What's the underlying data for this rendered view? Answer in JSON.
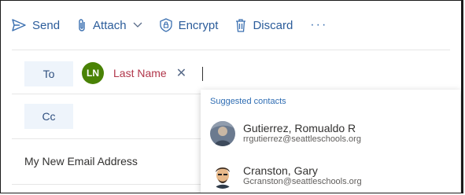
{
  "toolbar": {
    "send": "Send",
    "attach": "Attach",
    "encrypt": "Encrypt",
    "discard": "Discard",
    "more": "···"
  },
  "recipients": {
    "to_label": "To",
    "cc_label": "Cc",
    "chip": {
      "initials": "LN",
      "name": "Last Name",
      "remove": "✕"
    }
  },
  "subject": {
    "value": "My New Email Address"
  },
  "suggestions": {
    "header": "Suggested contacts",
    "contacts": [
      {
        "name": "Gutierrez, Romualdo R",
        "email": "rrgutierrez@seattleschools.org"
      },
      {
        "name": "Cranston, Gary",
        "email": "Gcranston@seattleschools.org"
      }
    ]
  },
  "colors": {
    "accent": "#2b5c9a",
    "chip_avatar": "#498205",
    "chip_name": "#b1364a"
  }
}
